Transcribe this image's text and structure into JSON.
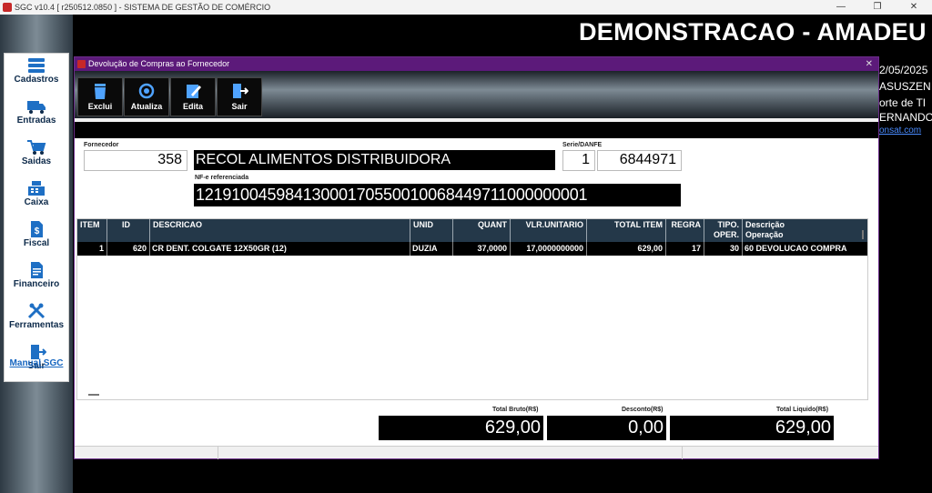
{
  "os_window": {
    "title": "SGC v10.4 [ r250512.0850 ] - SISTEMA DE GESTÃO DE COMÉRCIO",
    "minimize": "—",
    "maximize": "❐",
    "close": "✕"
  },
  "sidebar": {
    "items": [
      {
        "label": "Cadastros",
        "icon": "database-icon"
      },
      {
        "label": "Entradas",
        "icon": "truck-icon"
      },
      {
        "label": "Saidas",
        "icon": "cart-icon"
      },
      {
        "label": "Caixa",
        "icon": "cash-register-icon"
      },
      {
        "label": "Fiscal",
        "icon": "dollar-document-icon"
      },
      {
        "label": "Financeiro",
        "icon": "finance-document-icon"
      },
      {
        "label": "Ferramentas",
        "icon": "tools-icon"
      },
      {
        "label": "Sair",
        "icon": "exit-door-icon"
      }
    ],
    "manual_link": "Manual SGC"
  },
  "background": {
    "company_title": "DEMONSTRACAO - AMADEU",
    "info_lines": [
      "2/05/2025",
      "ASUSZEN",
      "orte de TI",
      "ERNANDO"
    ],
    "link_fragment": "onsat.com"
  },
  "modal": {
    "title": "Devolução de Compras ao Fornecedor",
    "close": "✕",
    "toolbar": {
      "exclui": "Exclui",
      "atualiza": "Atualiza",
      "edita": "Edita",
      "sair": "Sair"
    },
    "fornecedor_label": "Fornecedor",
    "fornecedor_code": "358",
    "fornecedor_name": "RECOL ALIMENTOS DISTRIBUIDORA",
    "serie_label": "Serie/DANFE",
    "serie": "1",
    "danfe": "6844971",
    "nfe_label": "NF-e referenciada",
    "nfe_key": "12191004598413000170550010068449711000000001",
    "grid": {
      "headers": {
        "item": "ITEM",
        "id": "ID",
        "descricao": "DESCRICAO",
        "unid": "UNID",
        "quant": "QUANT",
        "vlr_unitario": "VLR.UNITARIO",
        "total_item": "TOTAL ITEM",
        "regra": "REGRA",
        "tipo_line1": "TIPO.",
        "tipo_line2": "OPER.",
        "desc_op_line1": "Descrição",
        "desc_op_line2": "Operação"
      },
      "rows": [
        {
          "item": "1",
          "id": "620",
          "descricao": "CR DENT. COLGATE 12X50GR (12)",
          "unid": "DUZIA",
          "quant": "37,0000",
          "vlr_unitario": "17,0000000000",
          "total_item": "629,00",
          "regra": "17",
          "tipo_oper": "30",
          "descricao_operacao": "60 DEVOLUCAO COMPRA"
        }
      ]
    },
    "totals": {
      "bruto_label": "Total Bruto(R$)",
      "bruto": "629,00",
      "desconto_label": "Desconto(R$)",
      "desconto": "0,00",
      "liquido_label": "Total Liquido(R$)",
      "liquido": "629,00"
    }
  },
  "colors": {
    "modal_title": "#5c1a7a",
    "grid_header": "#243849",
    "link": "#1565c0"
  }
}
